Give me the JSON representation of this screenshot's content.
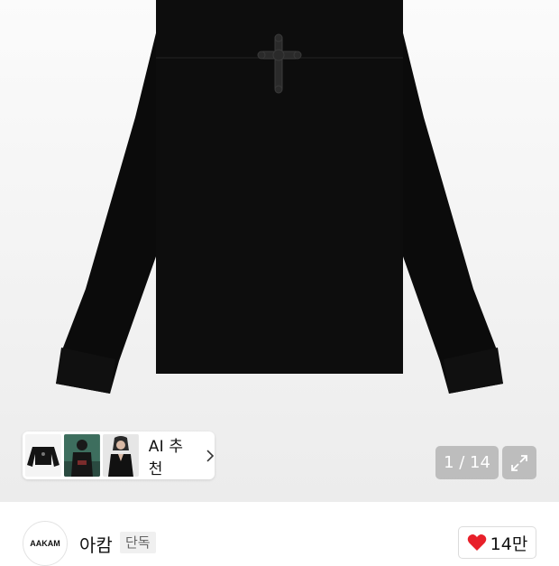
{
  "gallery": {
    "image": "black long sleeve t-shirt with cross graphic",
    "page_counter": "1 / 14",
    "ai_recommend": {
      "label": "AI 추천",
      "thumbnails": [
        "black-sweatshirt-thumb",
        "model-green-photo-thumb",
        "model-black-top-thumb"
      ]
    },
    "icons": {
      "expand": "expand-icon",
      "chevron": "chevron-right-icon"
    }
  },
  "brand": {
    "logo_text": "AAKAM",
    "name": "아캄",
    "badge": "단독"
  },
  "like": {
    "count": "14만",
    "icon": "heart-icon",
    "color": "#e8202a"
  }
}
